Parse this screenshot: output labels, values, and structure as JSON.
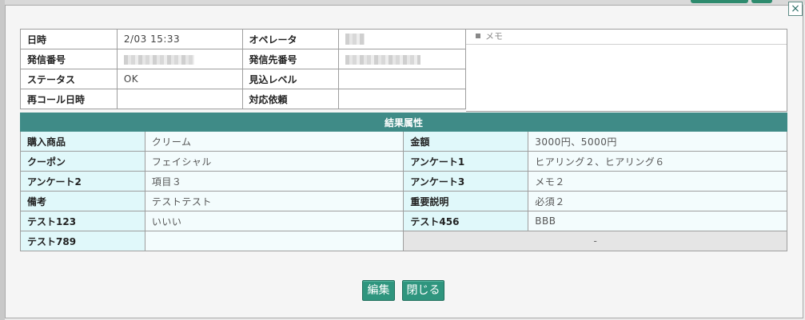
{
  "dialog": {
    "close_glyph": "×",
    "call_info": {
      "rows": [
        {
          "l1": "日時",
          "v1": "2/03 15:33",
          "l2": "オペレータ",
          "v2": ""
        },
        {
          "l1": "発信番号",
          "v1": "",
          "l2": "発信先番号",
          "v2": ""
        },
        {
          "l1": "ステータス",
          "v1": "OK",
          "l2": "見込レベル",
          "v2": ""
        },
        {
          "l1": "再コール日時",
          "v1": "",
          "l2": "対応依頼",
          "v2": ""
        }
      ]
    },
    "memo": {
      "label": "メモ",
      "content": ""
    },
    "result": {
      "header": "結果属性",
      "rows": [
        {
          "l1": "購入商品",
          "v1": "クリーム",
          "l2": "金額",
          "v2": "3000円、5000円"
        },
        {
          "l1": "クーポン",
          "v1": "フェイシャル",
          "l2": "アンケート1",
          "v2": "ヒアリング２、ヒアリング６"
        },
        {
          "l1": "アンケート2",
          "v1": "項目３",
          "l2": "アンケート3",
          "v2": "メモ２"
        },
        {
          "l1": "備考",
          "v1": "テストテスト",
          "l2": "重要説明",
          "v2": "必須２"
        },
        {
          "l1": "テスト123",
          "v1": "いいい",
          "l2": "テスト456",
          "v2": "BBB"
        },
        {
          "l1": "テスト789",
          "v1": "",
          "empty": "-"
        }
      ]
    },
    "buttons": {
      "edit": "編集",
      "close": "閉じる"
    }
  }
}
